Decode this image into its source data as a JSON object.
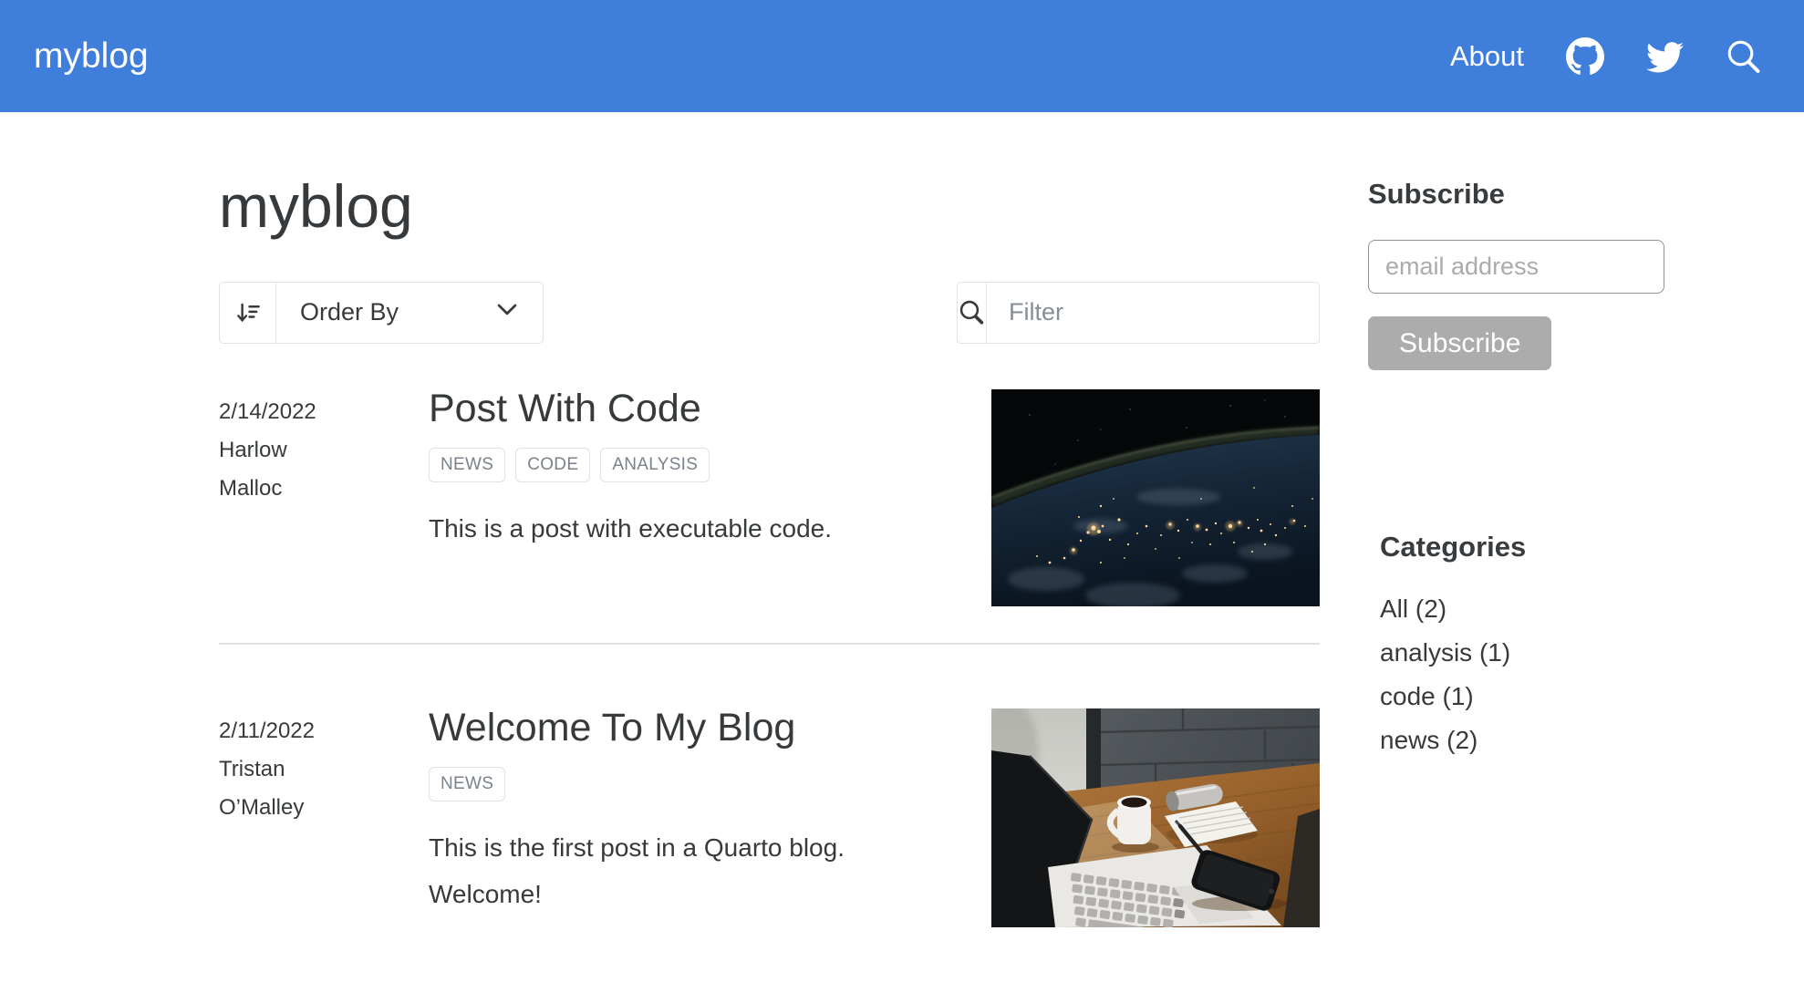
{
  "navbar": {
    "brand": "myblog",
    "about_label": "About",
    "icons": [
      "github-icon",
      "twitter-icon",
      "search-icon"
    ],
    "bg_color": "#407edc"
  },
  "page": {
    "title": "myblog"
  },
  "listing": {
    "order_by_label": "Order By",
    "filter_placeholder": "Filter",
    "posts": [
      {
        "date": "2/14/2022",
        "author": "Harlow Malloc",
        "title": "Post With Code",
        "tags": [
          "news",
          "code",
          "analysis"
        ],
        "description": "This is a post with executable code.",
        "image": "earth-at-night-from-space"
      },
      {
        "date": "2/11/2022",
        "author": "Tristan O’Malley",
        "title": "Welcome To My Blog",
        "tags": [
          "news"
        ],
        "description": "This is the first post in a Quarto blog. Welcome!",
        "image": "desk-with-laptop-coffee-notepad-phone"
      }
    ]
  },
  "sidebar": {
    "subscribe": {
      "heading": "Subscribe",
      "email_placeholder": "email address",
      "button_label": "Subscribe"
    },
    "categories": {
      "heading": "Categories",
      "items": [
        "All (2)",
        "analysis (1)",
        "code (1)",
        "news (2)"
      ]
    }
  },
  "colors": {
    "navbar_bg": "#407edc",
    "text_dark": "#373a3c",
    "border_light": "#dee2e6",
    "tag_text": "#7a828b",
    "placeholder": "#868e96",
    "button_gray": "#acacac"
  }
}
